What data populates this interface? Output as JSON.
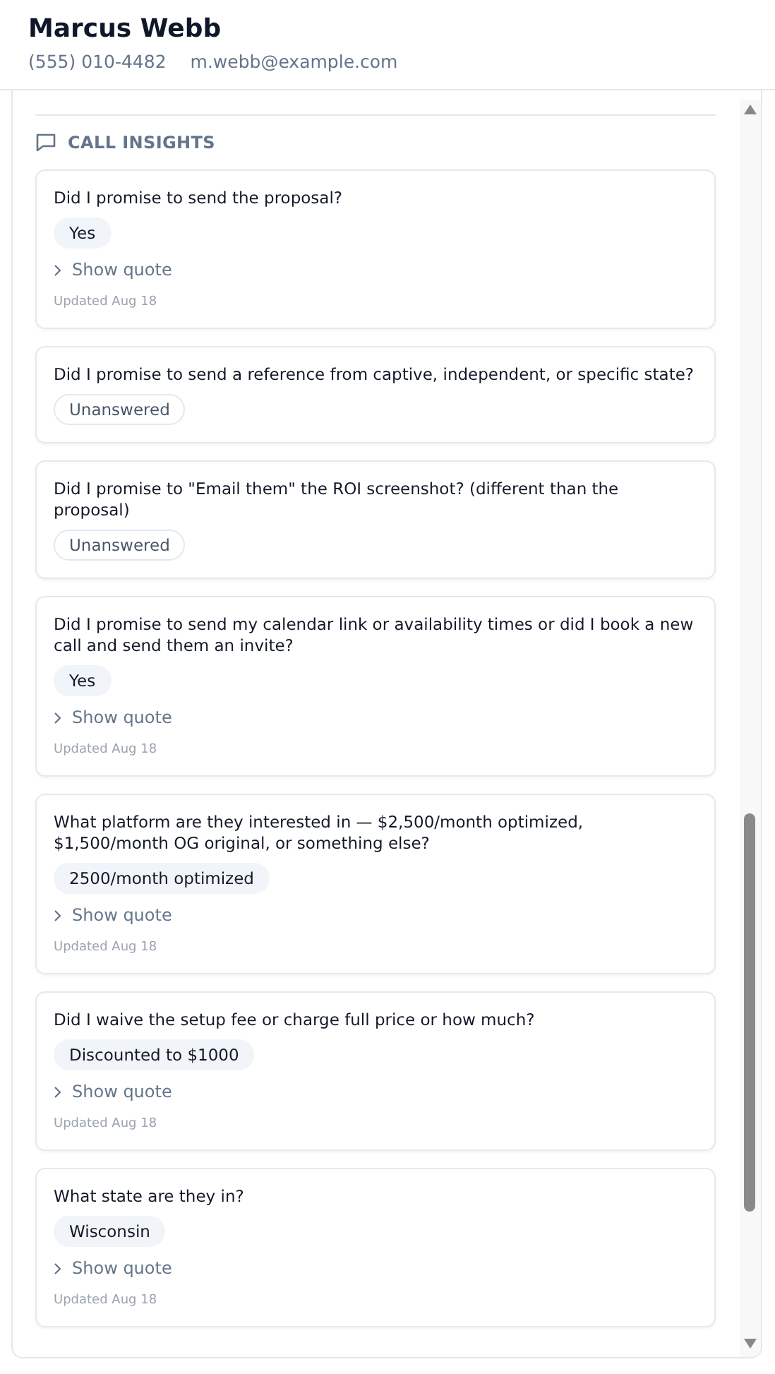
{
  "contact": {
    "name": "Marcus Webb",
    "phone": "(555) 010-4482",
    "email": "m.webb@example.com"
  },
  "section": {
    "title": "CALL INSIGHTS"
  },
  "insights": [
    {
      "question": "Did I promise to send the proposal?",
      "answered": true,
      "answer": "Yes",
      "quote_toggle": "Show quote",
      "updated": "Updated Aug 18"
    },
    {
      "question": "Did I promise to send a reference from captive, independent, or specific state?",
      "answered": false,
      "answer": "Unanswered"
    },
    {
      "question": "Did I promise to \"Email them\" the ROI screenshot? (different than the proposal)",
      "answered": false,
      "answer": "Unanswered"
    },
    {
      "question": "Did I promise to send my calendar link or availability times or did I book a new call and send them an invite?",
      "answered": true,
      "answer": "Yes",
      "quote_toggle": "Show quote",
      "updated": "Updated Aug 18"
    },
    {
      "question": "What platform are they interested in — $2,500/month optimized, $1,500/month OG original, or something else?",
      "answered": true,
      "answer": "2500/month optimized",
      "quote_toggle": "Show quote",
      "updated": "Updated Aug 18"
    },
    {
      "question": "Did I waive the setup fee or charge full price or how much?",
      "answered": true,
      "answer": "Discounted to $1000",
      "quote_toggle": "Show quote",
      "updated": "Updated Aug 18"
    },
    {
      "question": "What state are they in?",
      "answered": true,
      "answer": "Wisconsin",
      "quote_toggle": "Show quote",
      "updated": "Updated Aug 18"
    }
  ]
}
